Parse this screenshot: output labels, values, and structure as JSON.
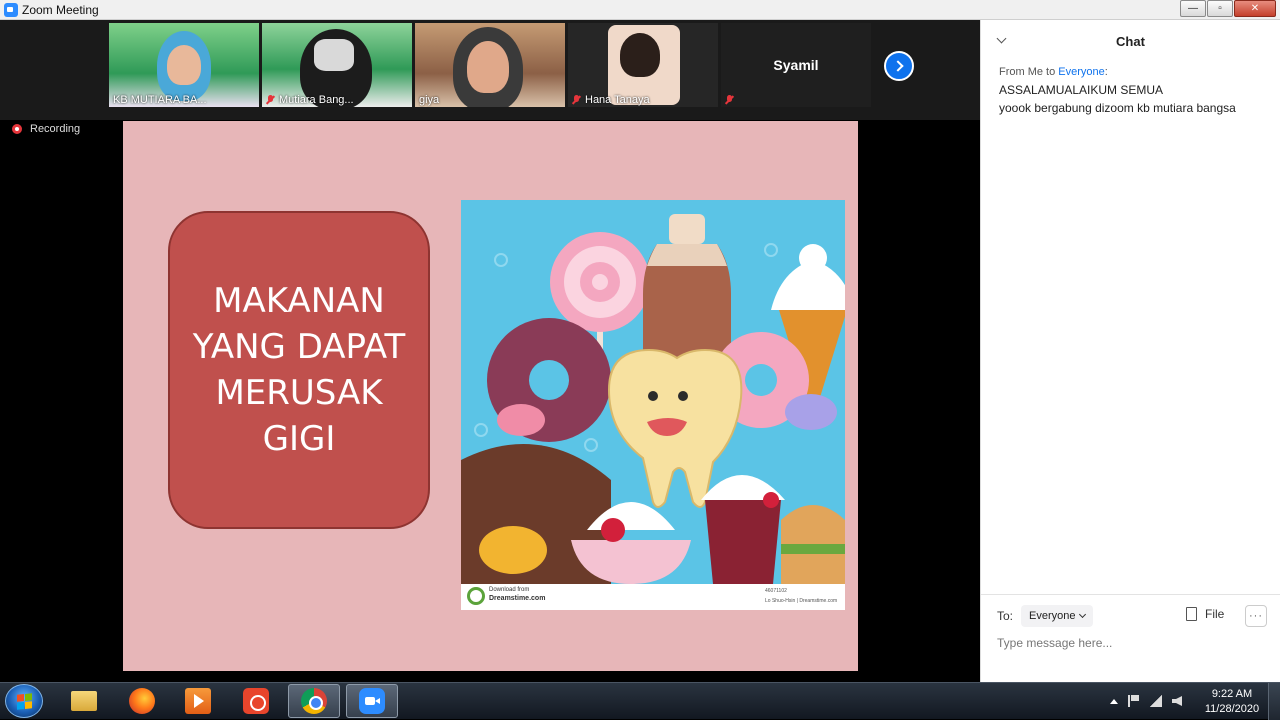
{
  "window": {
    "title": "Zoom Meeting",
    "controls": {
      "minimize": "—",
      "maximize": "▫",
      "close": "✕"
    }
  },
  "participants": [
    {
      "name": "KB MUTIARA BA...",
      "muted": false
    },
    {
      "name": "Mutiara Bang...",
      "muted": true
    },
    {
      "name": "giya",
      "muted": false
    },
    {
      "name": "Hana Tanaya",
      "muted": true
    },
    {
      "name": "Syamil",
      "muted": true,
      "video_off": true
    }
  ],
  "recording": {
    "label": "Recording"
  },
  "slide": {
    "heading_lines": [
      "MAKANAN",
      "YANG DAPAT",
      "MERUSAK",
      "GIGI"
    ],
    "image_footer": {
      "download_from": "Download from",
      "site": "Dreamstime.com",
      "id": "46071102",
      "credit": "Lo Shuo-Hsin | Dreamstime.com"
    },
    "colors": {
      "background": "#e7b6b8",
      "card": "#c0504d"
    }
  },
  "chat": {
    "title": "Chat",
    "from_prefix": "From Me to",
    "from_to": "Everyone",
    "from_suffix": ":",
    "messages": [
      "ASSALAMUALAIKUM SEMUA",
      "yoook bergabung dizoom kb mutiara bangsa"
    ],
    "to_label": "To:",
    "to_value": "Everyone",
    "file_label": "File",
    "more_label": "···",
    "input_placeholder": "Type message here..."
  },
  "taskbar": {
    "apps": [
      "file-explorer",
      "firefox",
      "media-player",
      "screen-recorder",
      "chrome",
      "zoom"
    ],
    "clock_time": "9:22 AM",
    "clock_date": "11/28/2020"
  }
}
